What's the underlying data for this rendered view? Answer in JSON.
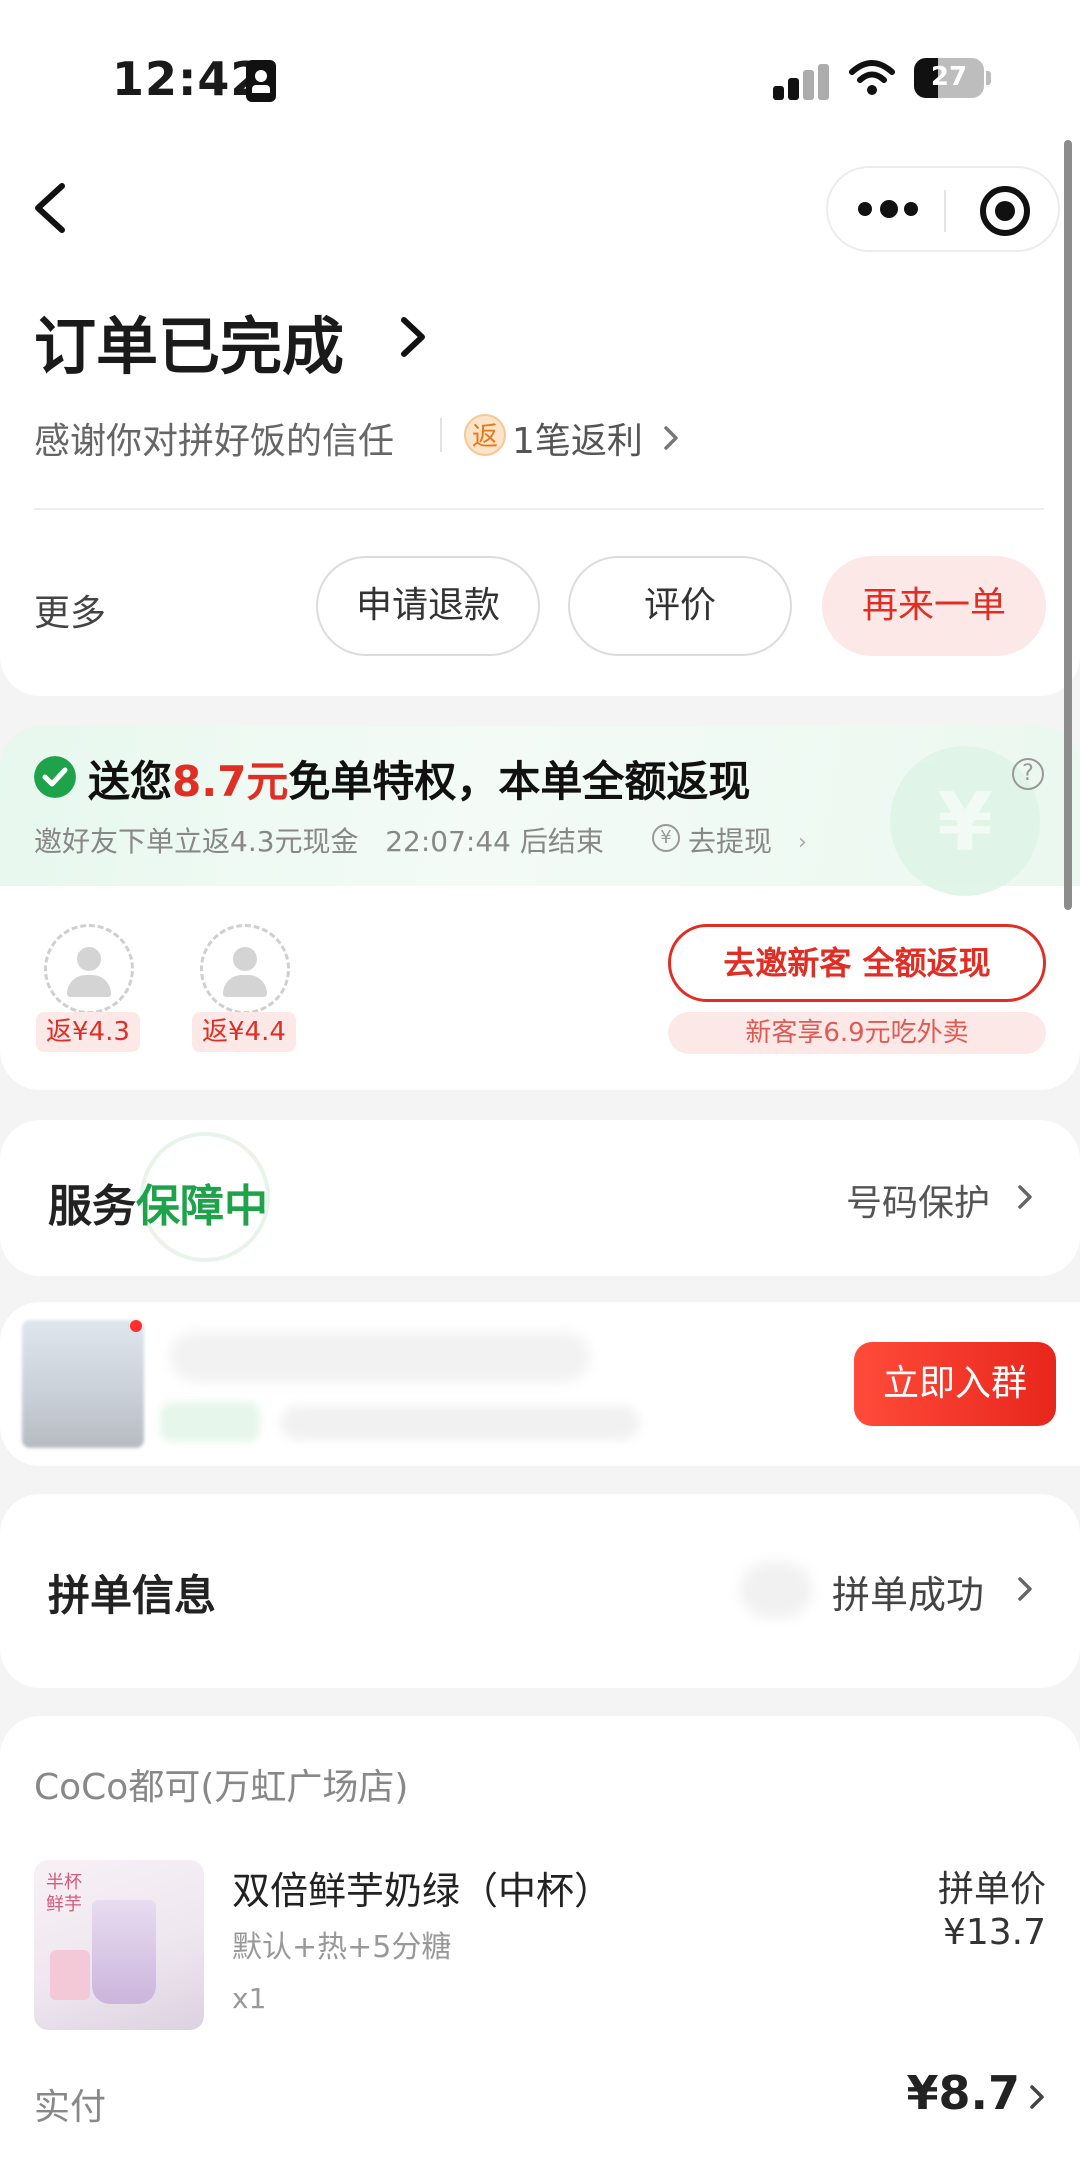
{
  "status_bar": {
    "time": "12:42",
    "battery": "27",
    "battery_level_percent": 27
  },
  "nav": {
    "back_icon": "chevron-left-icon",
    "more_icon": "more-dots-icon",
    "target_icon": "target-icon"
  },
  "order_status": {
    "title": "订单已完成",
    "subtitle": "感谢你对拼好饭的信任",
    "rebate_icon_text": "返",
    "rebate_text": "1笔返利"
  },
  "actions": {
    "more_label": "更多",
    "refund_label": "申请退款",
    "review_label": "评价",
    "reorder_label": "再来一单"
  },
  "free_order": {
    "title_prefix": "送您",
    "title_amount": "8.7元",
    "title_suffix": "免单特权，本单全额返现",
    "subtitle": "邀好友下单立返4.3元现金",
    "countdown": "22:07:44 后结束",
    "withdraw_label": "去提现",
    "coin_symbol": "¥",
    "help_symbol": "?",
    "slots": [
      {
        "return_label": "返¥4.3"
      },
      {
        "return_label": "返¥4.4"
      }
    ],
    "invite_button": "去邀新客 全额返现",
    "invite_sub": "新客享6.9元吃外卖"
  },
  "service": {
    "title_prefix": "服务",
    "title_highlight": "保障中",
    "right_label": "号码保护"
  },
  "group_ad": {
    "join_button": "立即入群"
  },
  "group_info": {
    "title": "拼单信息",
    "status": "拼单成功"
  },
  "order": {
    "shop_name": "CoCo都可(万虹广场店)",
    "product": {
      "image_label": "半杯\n鲜芋",
      "name": "双倍鲜芋奶绿（中杯）",
      "options": "默认+热+5分糖",
      "quantity": "x1",
      "price": "拼单价 ¥13.7"
    },
    "paid_label": "实付",
    "paid_value": "¥8.7"
  },
  "colors": {
    "accent_red": "#e02e24",
    "accent_green": "#1fa34a",
    "page_bg": "#f4f4f4"
  }
}
